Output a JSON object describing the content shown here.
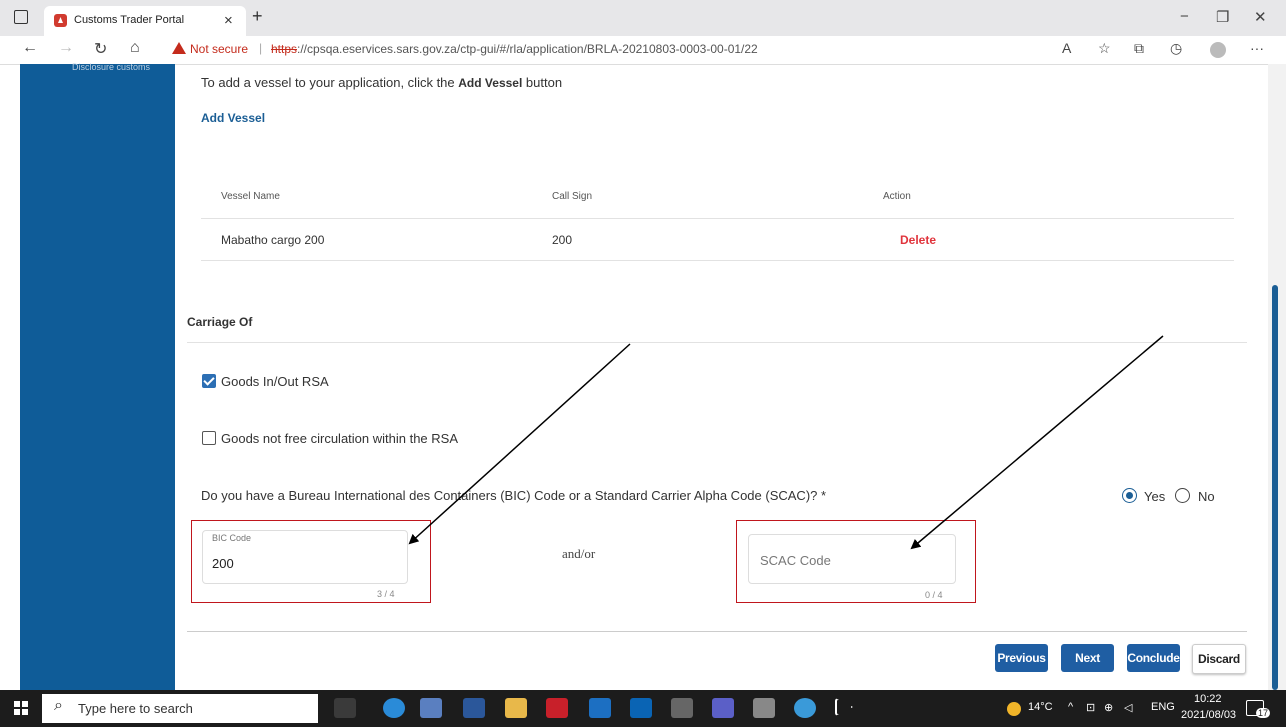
{
  "browser": {
    "tab_title": "Customs Trader Portal",
    "tab_close": "×",
    "new_tab": "+",
    "not_secure": "Not secure",
    "url_scheme": "https",
    "url_rest": "://cpsqa.eservices.sars.gov.za/ctp-gui/#/rla/application/BRLA-20210803-0003-00-01/22",
    "minimize": "−",
    "maximize": "❐",
    "close": "✕",
    "back": "←",
    "forward": "→",
    "refresh": "↻",
    "home": "⌂",
    "more": "···"
  },
  "sidebar": {
    "cut_text": "Disclosure customs"
  },
  "vessels": {
    "intro_text": "To add a vessel to your application, click the",
    "intro_button_ref": "Add Vessel",
    "intro_suffix": "button",
    "add_link": "Add Vessel",
    "headers": [
      "Vessel Name",
      "Call Sign",
      "Action"
    ],
    "rows": [
      {
        "name": "Mabatho cargo 200",
        "call_sign": "200",
        "action": "Delete"
      }
    ]
  },
  "carriage": {
    "title": "Carriage Of",
    "options": [
      {
        "label": "Goods In/Out RSA",
        "checked": true
      },
      {
        "label": "Goods not free circulation within the RSA",
        "checked": false
      }
    ],
    "question": "Do you have a Bureau International des Containers (BIC) Code or a Standard Carrier Alpha Code (SCAC)? *",
    "yes_label": "Yes",
    "no_label": "No",
    "selected": "Yes",
    "bic": {
      "label": "BIC Code",
      "value": "200",
      "counter": "3 / 4"
    },
    "andor": "and/or",
    "scac": {
      "placeholder": "SCAC Code",
      "value": "",
      "counter": "0 / 4"
    }
  },
  "actions": {
    "previous": "Previous",
    "next": "Next",
    "conclude": "Conclude",
    "discard": "Discard"
  },
  "taskbar": {
    "search_placeholder": "Type here to search",
    "weather": "14°C",
    "language": "ENG",
    "time": "10:22",
    "date": "2021/08/03",
    "notifications": "17"
  },
  "colors": {
    "brand_blue": "#0f5c98",
    "button_blue": "#1f5ea3",
    "delete_red": "#e0343c",
    "annotation_red": "#c0161d"
  }
}
